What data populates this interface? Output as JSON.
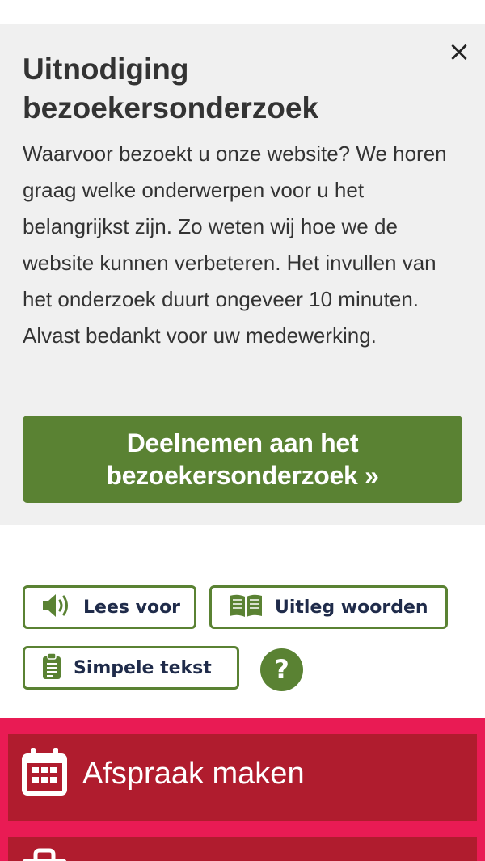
{
  "survey": {
    "close_label": "×",
    "title": "Uitnodiging bezoekersonderzoek",
    "body": "Waarvoor bezoekt u onze website? We horen graag welke onderwerpen voor u het belangrijkst zijn. Zo weten wij hoe we de website kunnen verbeteren. Het invullen van het onderzoek duurt ongeveer 10 minuten. Alvast bedankt voor uw medewerking.",
    "cta_label": "Deelnemen aan het bezoekersonderzoek »"
  },
  "tools": {
    "read_aloud": "Lees voor",
    "explain_words": "Uitleg woorden",
    "simple_text": "Simpele tekst",
    "help": "?"
  },
  "menu": {
    "items": [
      {
        "label": "Afspraak maken",
        "icon": "calendar-icon"
      },
      {
        "label": "",
        "icon": "briefcase-icon"
      }
    ]
  },
  "colors": {
    "accent_green": "#5a8233",
    "survey_bg": "#f0f0f0",
    "tile_red": "#b01c2e",
    "border_pink": "#e91b54",
    "tool_text": "#1f2b4a"
  }
}
